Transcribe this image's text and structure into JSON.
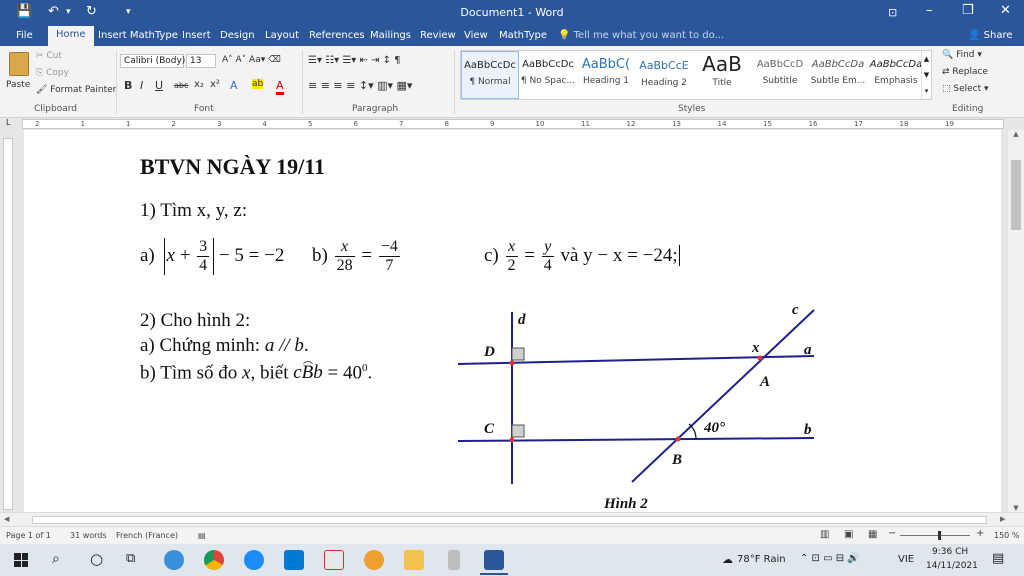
{
  "window": {
    "title": "Document1 - Word",
    "minimize": "–",
    "restore": "❐",
    "close": "✕"
  },
  "quick_access": {
    "save": "💾",
    "undo": "↶",
    "undo_more": "▾",
    "redo": "↻",
    "customize": "▾"
  },
  "tabs": [
    "File",
    "Home",
    "Insert MathType",
    "Insert",
    "Design",
    "Layout",
    "References",
    "Mailings",
    "Review",
    "View",
    "MathType"
  ],
  "active_tab": "Home",
  "tell_me": "Tell me what you want to do...",
  "share": "Share",
  "clipboard": {
    "paste": "Paste",
    "cut": "Cut",
    "copy": "Copy",
    "format_painter": "Format Painter",
    "label": "Clipboard"
  },
  "font": {
    "name": "Calibri (Body)",
    "size": "13",
    "label": "Font",
    "buttons": [
      "B",
      "I",
      "U",
      "abc",
      "x₂",
      "x²",
      "A",
      "ab",
      "A"
    ]
  },
  "paragraph": {
    "label": "Paragraph"
  },
  "styles": {
    "label": "Styles",
    "items": [
      {
        "preview": "AaBbCcDc",
        "name": "¶ Normal"
      },
      {
        "preview": "AaBbCcDc",
        "name": "¶ No Spac..."
      },
      {
        "preview": "AaBbC(",
        "name": "Heading 1"
      },
      {
        "preview": "AaBbCcE",
        "name": "Heading 2"
      },
      {
        "preview": "AaB",
        "name": "Title"
      },
      {
        "preview": "AaBbCcD",
        "name": "Subtitle"
      },
      {
        "preview": "AaBbCcDa",
        "name": "Subtle Em..."
      },
      {
        "preview": "AaBbCcDa",
        "name": "Emphasis"
      }
    ]
  },
  "editing": {
    "find": "Find",
    "replace": "Replace",
    "select": "Select",
    "label": "Editing"
  },
  "ruler": {
    "numbers": [
      "2",
      "1",
      "1",
      "2",
      "3",
      "4",
      "5",
      "6",
      "7",
      "8",
      "9",
      "10",
      "11",
      "12",
      "13",
      "14",
      "15",
      "16",
      "17",
      "18",
      "19"
    ]
  },
  "document": {
    "heading": "BTVN NGÀY 19/11",
    "q1": "1) Tìm x, y, z:",
    "q1a_label": "a)",
    "q1a_x": "x",
    "q1a_plus": "+",
    "q1a_num": "3",
    "q1a_den": "4",
    "q1a_rest": "− 5 = −2",
    "q1b_label": "b)",
    "q1b_num1": "x",
    "q1b_den1": "28",
    "q1b_eq": "=",
    "q1b_num2": "−4",
    "q1b_den2": "7",
    "q1c_label": "c)",
    "q1c_num1": "x",
    "q1c_den1": "2",
    "q1c_eq": "=",
    "q1c_num2": "y",
    "q1c_den2": "4",
    "q1c_rest": "và y − x  = −24;",
    "q2": "2) Cho hình 2:",
    "q2a": "a) Chứng minh:",
    "q2a_math": "a // b",
    "q2b": "b) Tìm số đo",
    "q2b_x": "x",
    "q2b_mid": ", biết",
    "q2b_angle": "cBb",
    "q2b_val": "= 40",
    "q2b_deg": "0",
    "q2b_end": "."
  },
  "figure": {
    "labels": {
      "d": "d",
      "c": "c",
      "D": "D",
      "a": "a",
      "x": "x",
      "A": "A",
      "C": "C",
      "b": "b",
      "B": "B",
      "angle": "40°"
    },
    "caption": "Hình 2",
    "line_color": "#1f1f8f"
  },
  "status": {
    "page": "Page 1 of 1",
    "words": "31 words",
    "language": "French (France)",
    "zoom": "150 %"
  },
  "taskbar": {
    "weather": "78°F  Rain",
    "lang": "VIE",
    "time": "9:36 CH",
    "date": "14/11/2021"
  }
}
